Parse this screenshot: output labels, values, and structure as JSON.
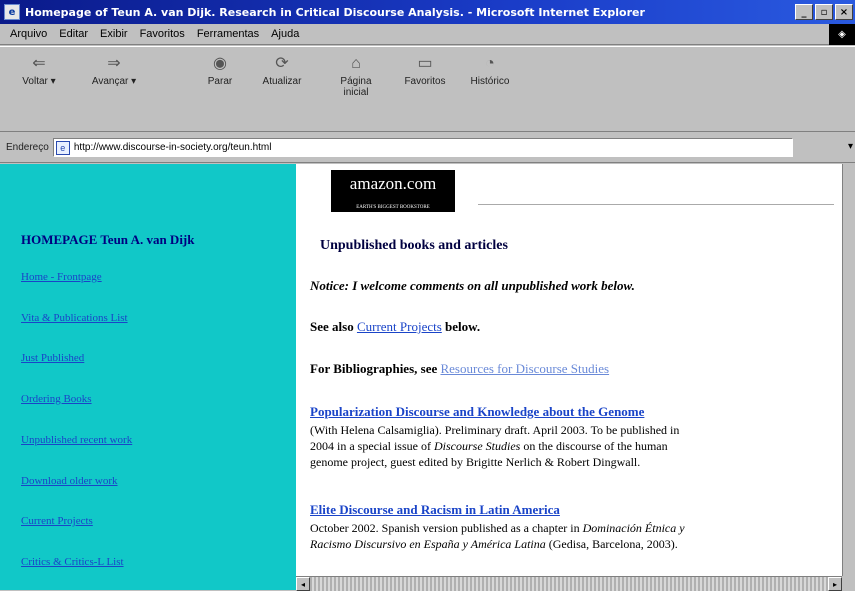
{
  "window": {
    "title": "Homepage of Teun A. van Dijk. Research in Critical Discourse Analysis. - Microsoft Internet Explorer",
    "controls": [
      "_",
      "▫",
      "×"
    ]
  },
  "menu": [
    "Arquivo",
    "Editar",
    "Exibir",
    "Favoritos",
    "Ferramentas",
    "Ajuda"
  ],
  "toolbar": [
    {
      "label": "Voltar",
      "icon": "back-arrow-icon",
      "glyph": "⇐"
    },
    {
      "label": "Avançar",
      "icon": "forward-arrow-icon",
      "glyph": "⇒"
    },
    {
      "label": "Parar",
      "icon": "stop-icon",
      "glyph": "◉"
    },
    {
      "label": "Atualizar",
      "icon": "refresh-icon",
      "glyph": "⟳"
    },
    {
      "label": "Página inicial",
      "icon": "home-icon",
      "glyph": "⌂"
    },
    {
      "label": "Favoritos",
      "icon": "favorites-icon",
      "glyph": "▭"
    },
    {
      "label": "Histórico",
      "icon": "history-icon",
      "glyph": "◔"
    }
  ],
  "address": {
    "label": "Endereço",
    "url": "http://www.discourse-in-society.org/teun.html"
  },
  "sidebar": {
    "home": "HOMEPAGE Teun A. van Dijk",
    "links": [
      "Home - Frontpage",
      "Vita & Publications List",
      "Just Published",
      "Ordering Books",
      "Unpublished recent work",
      "Download older work",
      "Current Projects",
      "Critics & Critics-L List"
    ]
  },
  "content": {
    "amazon": "amazon.com",
    "amazon_tag": "EARTH'S BIGGEST BOOKSTORE",
    "heading": "Unpublished books and articles",
    "notice": "Notice: I welcome comments on all unpublished work below.",
    "see_also_prefix": "See also",
    "see_also_link": "Current Projects",
    "see_also_suffix": "below.",
    "biblio_prefix": "For Bibliographies, see",
    "biblio_link": "Resources for Discourse Studies",
    "entries": [
      {
        "title": "Popularization Discourse and Knowledge about the Genome",
        "p1": "(With Helena Calsamiglia). Preliminary draft. April 2003. To be published in",
        "p2_a": "2004 in a special issue of",
        "p2_em": "Discourse Studies",
        "p2_b": "on the discourse of the human",
        "p3": "genome project, guest edited by Brigitte Nerlich & Robert Dingwall."
      },
      {
        "title": "Elite Discourse and Racism in Latin America",
        "p1_a": "October 2002. Spanish version published as a chapter in",
        "p1_em": "Dominación Étnica y",
        "p2_em": "Racismo Discursivo en España y América Latina",
        "p2_b": "(Gedisa, Barcelona, 2003)."
      }
    ]
  }
}
